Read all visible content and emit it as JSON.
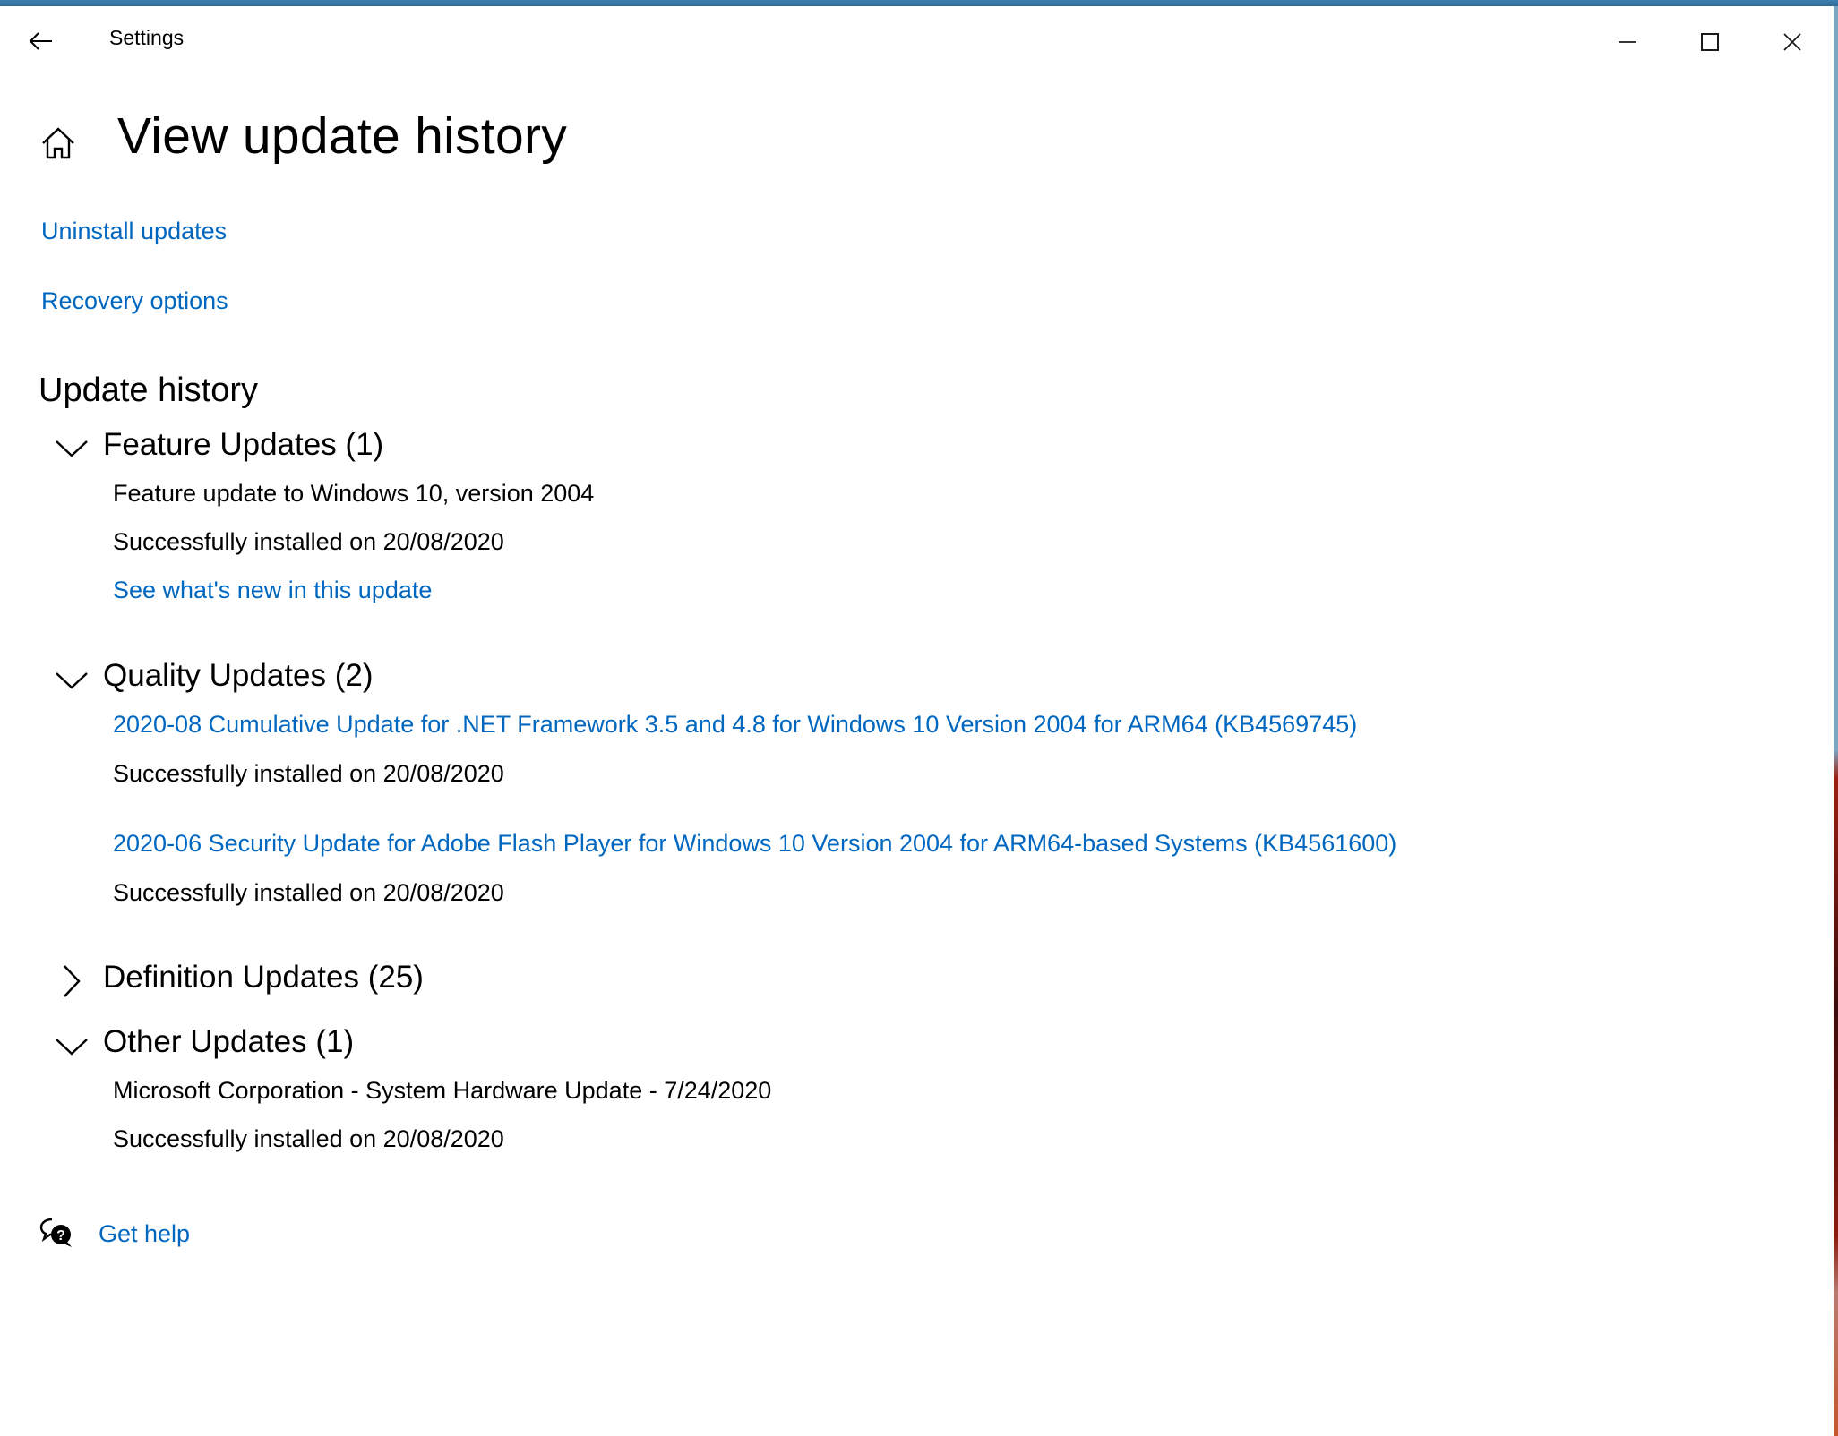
{
  "window": {
    "title": "Settings",
    "controls": {
      "minimize": "minimize-icon",
      "maximize": "maximize-icon",
      "close": "close-icon"
    }
  },
  "page": {
    "title": "View update history",
    "links": {
      "uninstall": "Uninstall updates",
      "recovery": "Recovery options"
    },
    "section_title": "Update history"
  },
  "groups": {
    "feature": {
      "title": "Feature Updates (1)",
      "expanded": true,
      "items": [
        {
          "name": "Feature update to Windows 10, version 2004",
          "is_link": false,
          "status": "Successfully installed on 20/08/2020",
          "extra_link": "See what's new in this update"
        }
      ]
    },
    "quality": {
      "title": "Quality Updates (2)",
      "expanded": true,
      "items": [
        {
          "name": "2020-08 Cumulative Update for .NET Framework 3.5 and 4.8 for Windows 10 Version 2004 for ARM64 (KB4569745)",
          "is_link": true,
          "status": "Successfully installed on 20/08/2020"
        },
        {
          "name": "2020-06 Security Update for Adobe Flash Player for Windows 10 Version 2004 for ARM64-based Systems (KB4561600)",
          "is_link": true,
          "status": "Successfully installed on 20/08/2020"
        }
      ]
    },
    "definition": {
      "title": "Definition Updates (25)",
      "expanded": false
    },
    "other": {
      "title": "Other Updates (1)",
      "expanded": true,
      "items": [
        {
          "name": "Microsoft Corporation - System Hardware Update - 7/24/2020",
          "is_link": false,
          "status": "Successfully installed on 20/08/2020"
        }
      ]
    }
  },
  "help": {
    "label": "Get help",
    "icon": "help-chat-icon"
  },
  "colors": {
    "link": "#0067c0",
    "text": "#000000",
    "titlebar_border": "#2c6a99"
  }
}
